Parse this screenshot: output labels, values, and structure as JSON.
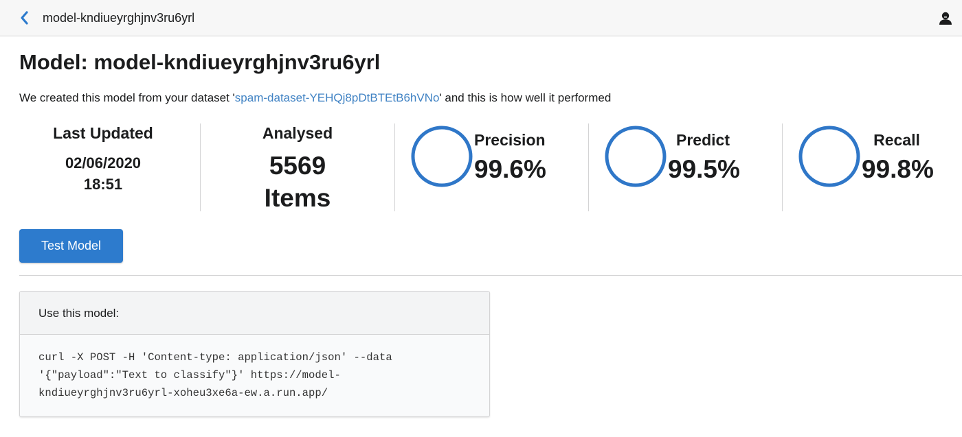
{
  "header": {
    "title": "model-kndiueyrghjnv3ru6yrl"
  },
  "page": {
    "title": "Model: model-kndiueyrghjnv3ru6yrl",
    "intro_prefix": "We created this model from your dataset '",
    "dataset_link": "spam-dataset-YEHQj8pDtBTEtB6hVNo",
    "intro_suffix": "' and this is how well it performed"
  },
  "stats": {
    "last_updated": {
      "label": "Last Updated",
      "date": "02/06/2020",
      "time": "18:51"
    },
    "analysed": {
      "label": "Analysed",
      "count": "5569",
      "unit": "Items"
    }
  },
  "metrics": [
    {
      "label": "Precision",
      "value": "99.6%"
    },
    {
      "label": "Predict",
      "value": "99.5%"
    },
    {
      "label": "Recall",
      "value": "99.8%"
    }
  ],
  "actions": {
    "test_model_label": "Test Model"
  },
  "usage": {
    "header": "Use this model:",
    "code_lines": [
      "curl -X POST -H 'Content-type: application/json' --data",
      "'{\"payload\":\"Text to classify\"}' https://model-",
      "kndiueyrghjnv3ru6yrl-xoheu3xe6a-ew.a.run.app/"
    ]
  },
  "icons": {
    "back": "chevron-left-icon",
    "user": "user-icon",
    "metric_ring": "circle-outline-icon"
  },
  "colors": {
    "accent": "#2d7bcd",
    "link": "#4183c4",
    "topbar": "#f7f7f7",
    "ring": "#2f77c8"
  }
}
